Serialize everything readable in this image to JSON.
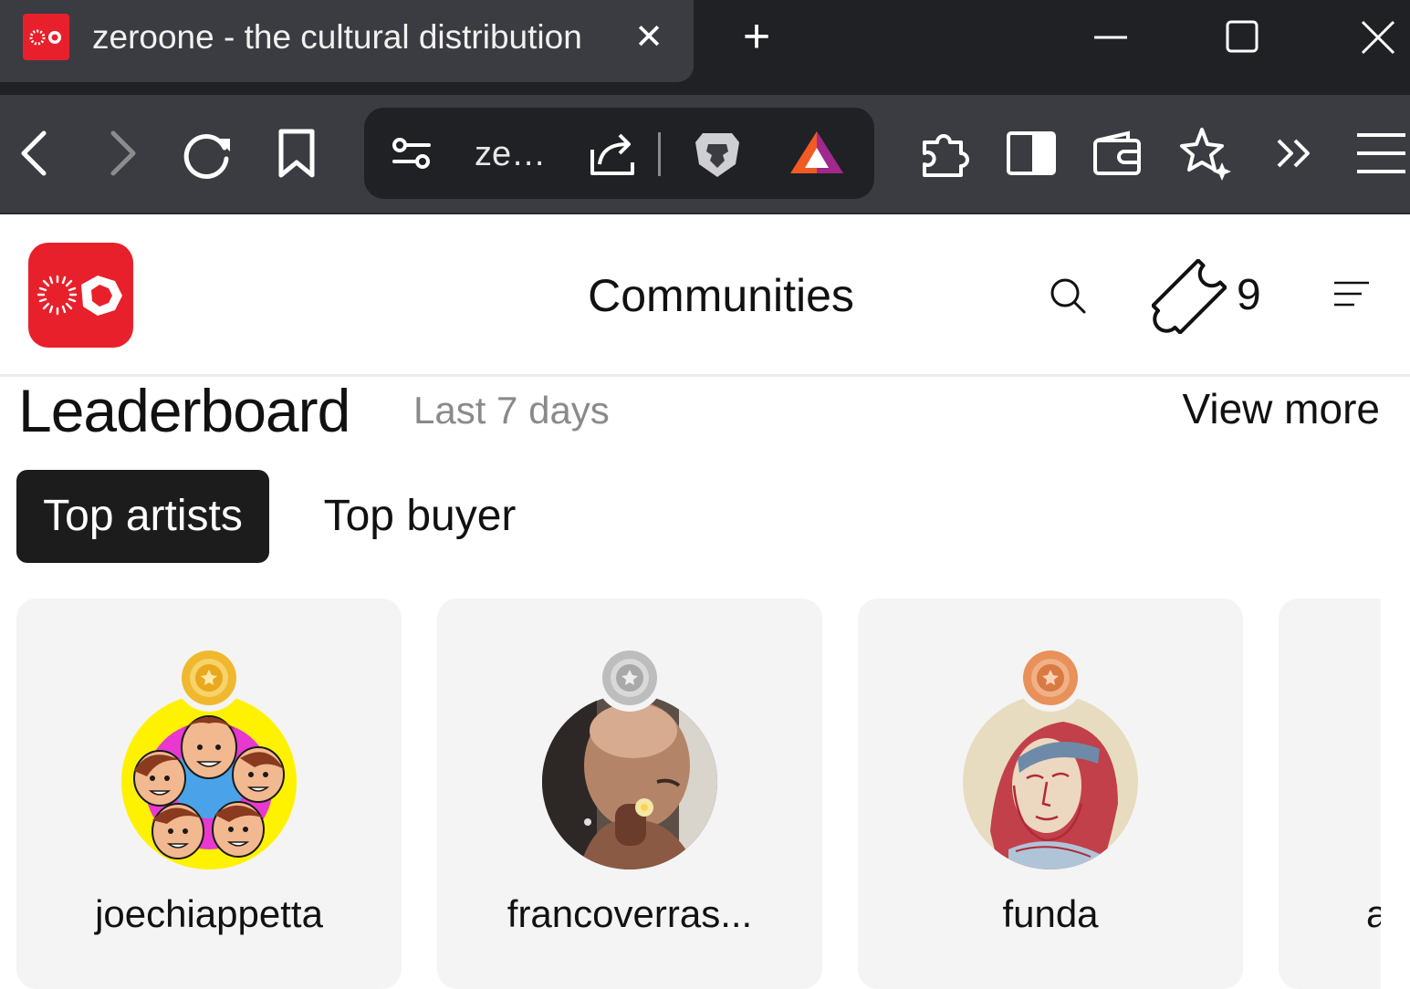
{
  "browser": {
    "tab_title": "zeroone - the cultural distribution",
    "url": "ze…",
    "close_tab_glyph": "✕",
    "new_tab_glyph": "+",
    "icons": [
      "chevron-left-icon",
      "chevron-right-icon",
      "reload-icon",
      "bookmark-icon",
      "site-settings-icon",
      "share-icon",
      "brave-shields-icon",
      "brave-rewards-icon",
      "extensions-icon",
      "sidebar-icon",
      "wallet-icon",
      "leo-ai-icon",
      "more-tools-icon",
      "menu-icon"
    ],
    "window_controls": [
      "minimize-icon",
      "maximize-icon",
      "close-window-icon"
    ]
  },
  "site": {
    "header_title": "Communities",
    "ticket_count": "9",
    "brand_color": "#e8202b"
  },
  "leaderboard": {
    "title": "Leaderboard",
    "period": "Last 7 days",
    "view_more": "View more",
    "tabs": [
      {
        "label": "Top artists",
        "active": true
      },
      {
        "label": "Top buyer",
        "active": false
      }
    ],
    "cards": [
      {
        "name": "joechiappetta",
        "medal": "gold",
        "medal_color": "#f0b82f"
      },
      {
        "name": "francoverras...",
        "medal": "silver",
        "medal_color": "#bdbdbd"
      },
      {
        "name": "funda",
        "medal": "bronze",
        "medal_color": "#e8915a"
      },
      {
        "name": "a",
        "medal": "",
        "medal_color": ""
      }
    ]
  }
}
